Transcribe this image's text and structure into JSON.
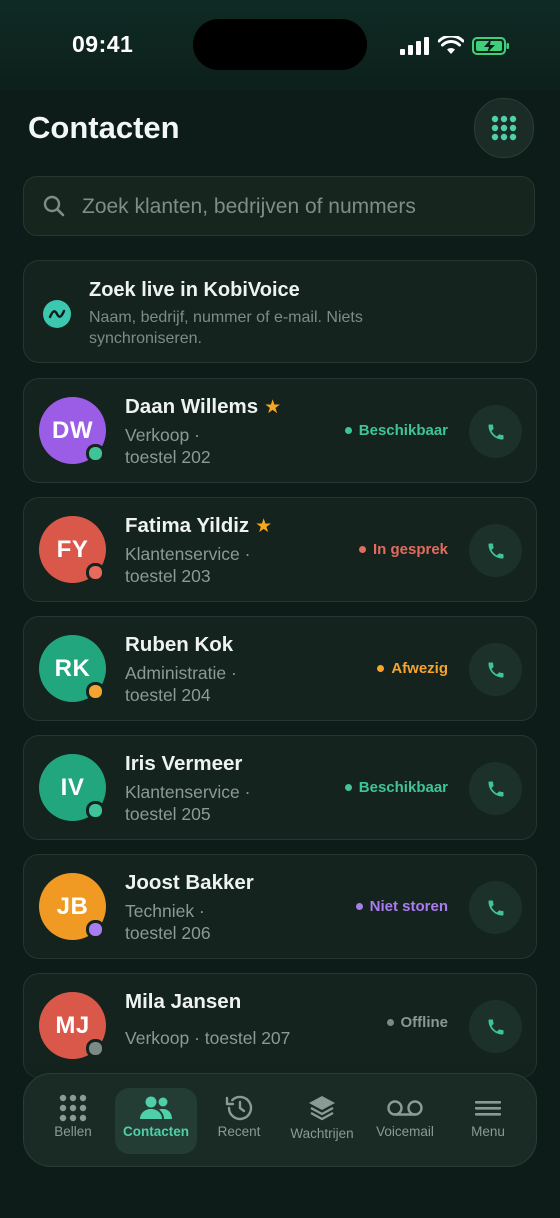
{
  "status_bar": {
    "time": "09:41"
  },
  "header": {
    "title": "Contacten"
  },
  "search": {
    "placeholder": "Zoek klanten, bedrijven of nummers"
  },
  "live_search": {
    "title": "Zoek live in KobiVoice",
    "subtitle": "Naam, bedrijf, nummer of e-mail. Niets synchroniseren."
  },
  "contacts": [
    {
      "initials": "DW",
      "name": "Daan Willems",
      "favorite": true,
      "dept_line1": "Verkoop ·",
      "dept_line2": "toestel 202",
      "status": "Beschikbaar",
      "status_color": "#3fc49a",
      "avatar_color": "#9b5de5"
    },
    {
      "initials": "FY",
      "name": "Fatima Yildiz",
      "favorite": true,
      "dept_line1": "Klantenservice ·",
      "dept_line2": "toestel 203",
      "status": "In gesprek",
      "status_color": "#e56b5d",
      "avatar_color": "#d9584a"
    },
    {
      "initials": "RK",
      "name": "Ruben Kok",
      "favorite": false,
      "dept_line1": "Administratie ·",
      "dept_line2": "toestel 204",
      "status": "Afwezig",
      "status_color": "#f5a331",
      "avatar_color": "#22a67e"
    },
    {
      "initials": "IV",
      "name": "Iris Vermeer",
      "favorite": false,
      "dept_line1": "Klantenservice ·",
      "dept_line2": "toestel 205",
      "status": "Beschikbaar",
      "status_color": "#3fc49a",
      "avatar_color": "#22a67e"
    },
    {
      "initials": "JB",
      "name": "Joost Bakker",
      "favorite": false,
      "dept_line1": "Techniek ·",
      "dept_line2": "toestel 206",
      "status": "Niet storen",
      "status_color": "#a97cf0",
      "avatar_color": "#f09a24"
    },
    {
      "initials": "MJ",
      "name": "Mila Jansen",
      "favorite": false,
      "dept_line1": "Verkoop · toestel 207",
      "dept_line2": "",
      "status": "Offline",
      "status_color": "#7c8a86",
      "avatar_color": "#d9584a"
    }
  ],
  "tabbar": {
    "items": [
      {
        "label": "Bellen",
        "icon": "keypad-icon",
        "active": false
      },
      {
        "label": "Contacten",
        "icon": "people-icon",
        "active": true
      },
      {
        "label": "Recent",
        "icon": "history-icon",
        "active": false
      },
      {
        "label": "Wachtrijen",
        "icon": "layers-icon",
        "active": false
      },
      {
        "label": "Voicemail",
        "icon": "voicemail-icon",
        "active": false
      },
      {
        "label": "Menu",
        "icon": "menu-icon",
        "active": false
      }
    ]
  },
  "colors": {
    "accent": "#4fd0a8",
    "background": "#0d1c18",
    "card": "#15231e"
  }
}
